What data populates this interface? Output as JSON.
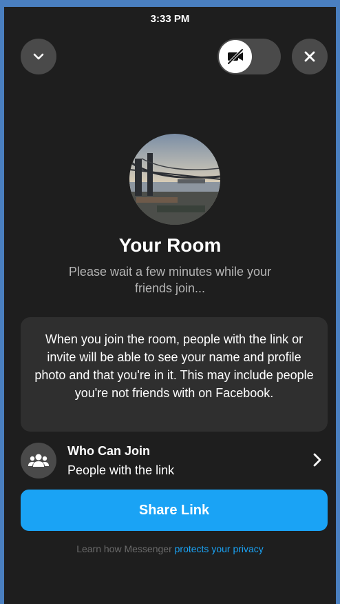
{
  "status_bar": {
    "time": "3:33 PM"
  },
  "header": {
    "collapse_icon": "chevron-down-icon",
    "camera_toggle_icon": "video-off-icon",
    "close_icon": "close-icon"
  },
  "room": {
    "title": "Your Room",
    "subtitle": "Please wait a few minutes while your friends join..."
  },
  "notice": {
    "text": "When you join the room, people with the link or invite will be able to see your name and profile photo and that you're in it. This may include people you're not friends with on Facebook."
  },
  "who_can_join": {
    "label": "Who Can Join",
    "value": "People with the link"
  },
  "share_button": {
    "label": "Share Link"
  },
  "footer": {
    "text": "Learn how Messenger ",
    "link": "protects your privacy"
  },
  "colors": {
    "accent": "#1aa3f5",
    "background": "#1e1e1e",
    "card": "#2f2f2f"
  }
}
